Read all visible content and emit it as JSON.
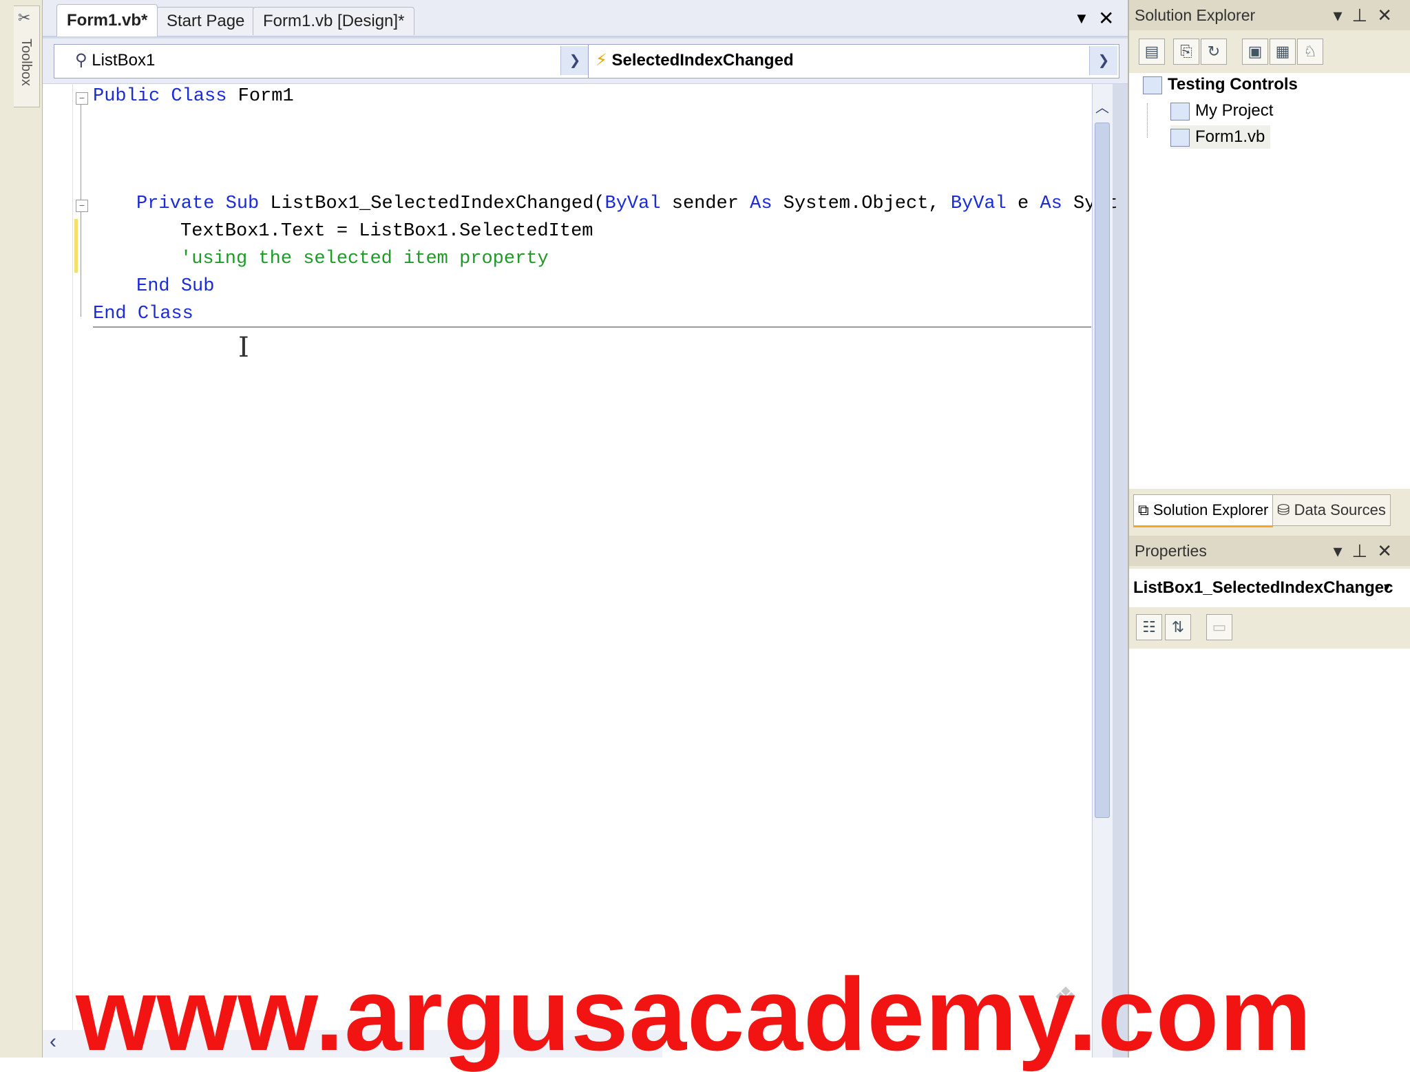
{
  "toolbox": {
    "label": "Toolbox"
  },
  "tabs": [
    {
      "label": "Form1.vb*",
      "active": true
    },
    {
      "label": "Start Page",
      "active": false
    },
    {
      "label": "Form1.vb [Design]*",
      "active": false
    }
  ],
  "editor": {
    "object_combo": "ListBox1",
    "event_combo": "SelectedIndexChanged",
    "code": {
      "l1_kw1": "Public",
      "l1_kw2": "Class",
      "l1_name": " Form1",
      "l2_kw1": "Private",
      "l2_kw2": "Sub",
      "l2_sig": " ListBox1_SelectedIndexChanged(",
      "l2_kw3": "ByVal",
      "l2_p1": " sender ",
      "l2_kw4": "As",
      "l2_t1": " System.Object, ",
      "l2_kw5": "ByVal",
      "l2_p2": " e ",
      "l2_kw6": "As",
      "l2_t2": " Syst",
      "l3": "TextBox1.Text = ListBox1.SelectedItem",
      "l4": "'using the selected item property",
      "l5_kw1": "End",
      "l5_kw2": "Sub",
      "l6_kw1": "End",
      "l6_kw2": "Class"
    }
  },
  "solution_explorer": {
    "title": "Solution Explorer",
    "tree": {
      "root": "Testing Controls",
      "items": [
        "My Project",
        "Form1.vb"
      ]
    },
    "tabs": [
      "Solution Explorer",
      "Data Sources"
    ]
  },
  "properties": {
    "title": "Properties",
    "object": "ListBox1_SelectedIndexChangec"
  },
  "watermark": {
    "text": "www.argusacademy.com"
  },
  "colors": {
    "keyword": "#1c2bd8",
    "comment": "#1f9a2a",
    "watermark": "#f21313"
  }
}
